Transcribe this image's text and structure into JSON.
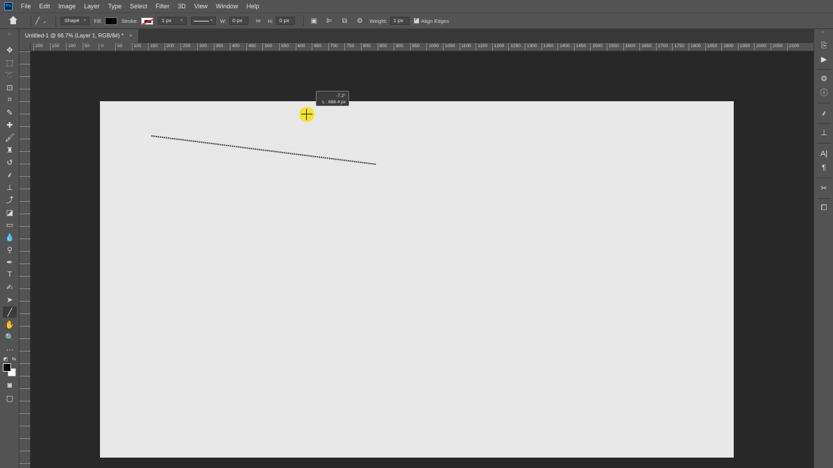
{
  "menubar": {
    "app_icon": "Ps",
    "items": [
      "File",
      "Edit",
      "Image",
      "Layer",
      "Type",
      "Select",
      "Filter",
      "3D",
      "View",
      "Window",
      "Help"
    ]
  },
  "options": {
    "mode": "Shape",
    "fill_label": "Fill:",
    "fill_color": "#000000",
    "stroke_label": "Stroke:",
    "stroke_width": "1 px",
    "w_label": "W:",
    "w_value": "0 px",
    "h_label": "H:",
    "h_value": "0 px",
    "weight_label": "Weight:",
    "weight_value": "1 px",
    "align_edges_label": "Align Edges",
    "align_edges_checked": true
  },
  "document": {
    "tab_title": "Untitled-1 @ 66.7% (Layer 1, RGB/8#) *",
    "close_glyph": "×"
  },
  "ruler": {
    "top_ticks": [
      "200",
      "150",
      "100",
      "50",
      "0",
      "50",
      "100",
      "150",
      "200",
      "250",
      "300",
      "350",
      "400",
      "450",
      "500",
      "550",
      "600",
      "650",
      "700",
      "750",
      "800",
      "850",
      "900",
      "950",
      "1000",
      "1050",
      "1100",
      "1150",
      "1200",
      "1250",
      "1300",
      "1350",
      "1400",
      "1450",
      "1500",
      "1550",
      "1600",
      "1650",
      "1700",
      "1750",
      "1800",
      "1850",
      "1900",
      "1950",
      "2000",
      "2050",
      "2100"
    ]
  },
  "measure_tooltip": {
    "angle": "-7.2°",
    "length": "L :  688.4 px"
  },
  "tools": [
    "move-icon",
    "marquee-icon",
    "lasso-icon",
    "object-select-icon",
    "crop-icon",
    "eyedropper-icon",
    "healing-brush-icon",
    "brush-icon",
    "clone-stamp-icon",
    "history-brush-icon",
    "eraser-icon",
    "gradient-icon",
    "blur-icon",
    "dodge-icon",
    "pen-icon",
    "type-icon",
    "path-select-icon",
    "line-tool-icon",
    "hand-icon",
    "zoom-icon",
    "more-tools-icon"
  ],
  "colors": {
    "foreground": "#000000",
    "background": "#ffffff",
    "canvas": "#e8e8e8",
    "cursor_highlight": "#f4e11d"
  }
}
